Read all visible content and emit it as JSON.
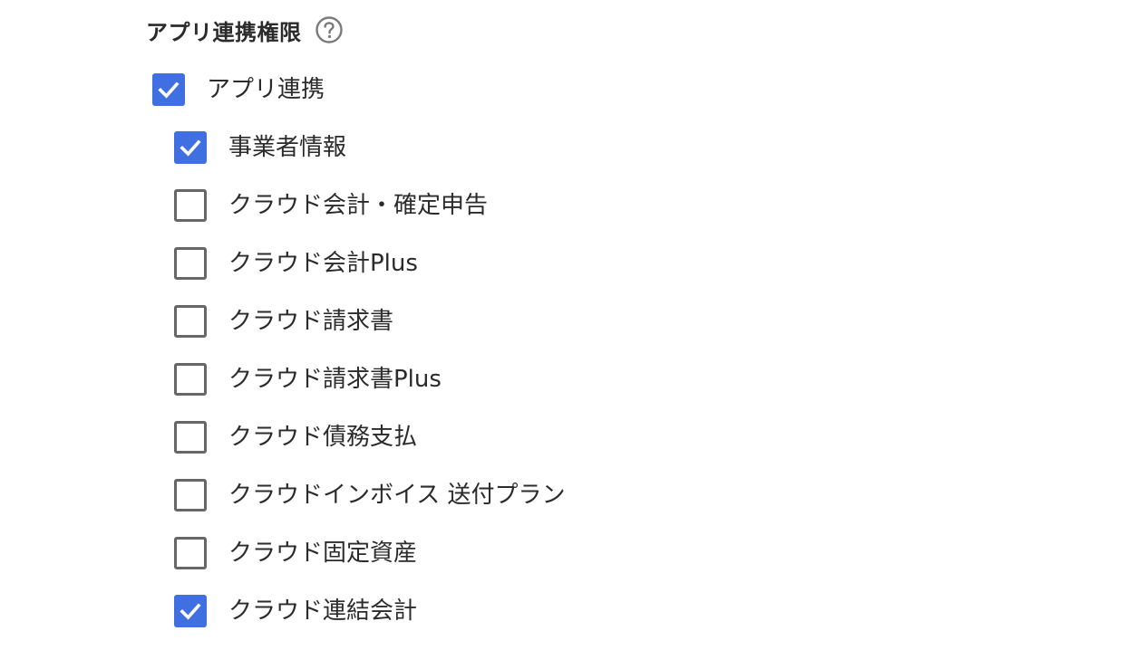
{
  "section": {
    "title": "アプリ連携権限",
    "help_icon": "question-circle-icon"
  },
  "parent_item": {
    "label": "アプリ連携",
    "checked": true
  },
  "items": [
    {
      "label": "事業者情報",
      "checked": true
    },
    {
      "label": "クラウド会計・確定申告",
      "checked": false
    },
    {
      "label": "クラウド会計Plus",
      "checked": false
    },
    {
      "label": "クラウド請求書",
      "checked": false
    },
    {
      "label": "クラウド請求書Plus",
      "checked": false
    },
    {
      "label": "クラウド債務支払",
      "checked": false
    },
    {
      "label": "クラウドインボイス 送付プラン",
      "checked": false
    },
    {
      "label": "クラウド固定資産",
      "checked": false
    },
    {
      "label": "クラウド連結会計",
      "checked": true
    }
  ],
  "colors": {
    "accent": "#3f6fe0",
    "checkbox_border": "#666666",
    "text": "#2b2b2b"
  }
}
